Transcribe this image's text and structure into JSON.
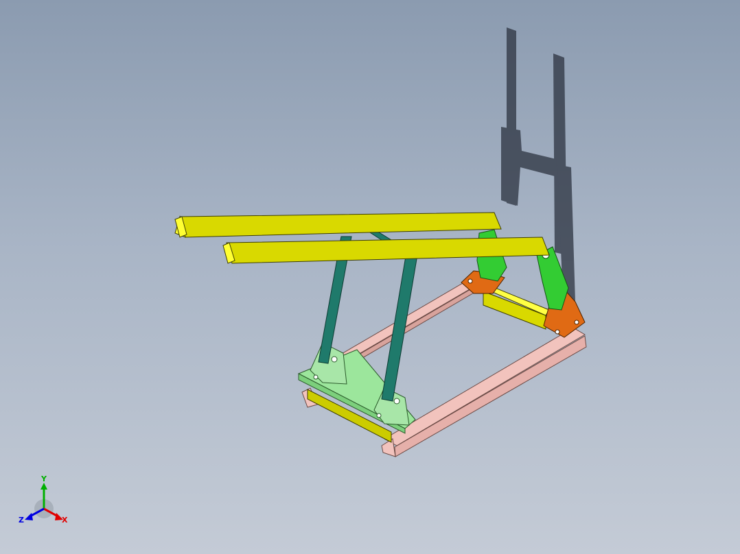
{
  "viewport": {
    "background_top": "#8b9bb0",
    "background_bottom": "#c4cbd6"
  },
  "model": {
    "colors": {
      "beam_yellow": "#d9d900",
      "beam_end": "#ffff33",
      "base_rail_pink": "#f2c3bd",
      "lever_teal": "#1f7a6b",
      "pivot_green": "#33cc33",
      "mount_orange": "#e06a14",
      "base_plate_light_green": "#9ce69c",
      "shadow": "#2c3340"
    }
  },
  "triad": {
    "x_label": "X",
    "y_label": "Y",
    "z_label": "Z",
    "x_color": "#e00000",
    "y_color": "#00b000",
    "z_color": "#0000e0"
  }
}
